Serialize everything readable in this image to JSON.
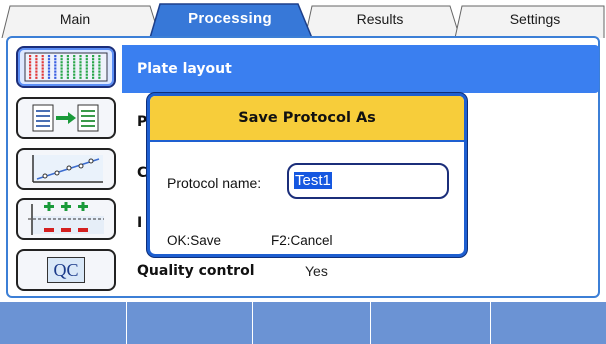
{
  "tabs": [
    {
      "label": "Main",
      "active": false
    },
    {
      "label": "Processing",
      "active": true
    },
    {
      "label": "Results",
      "active": false
    },
    {
      "label": "Settings",
      "active": false
    }
  ],
  "items": [
    {
      "icon": "plate-layout-icon",
      "label": "Plate layout",
      "selected": true
    },
    {
      "icon": "transform-icon",
      "label": "P",
      "selected": false
    },
    {
      "icon": "curve-fit-icon",
      "label": "C",
      "selected": false
    },
    {
      "icon": "cutoff-icon",
      "label": "I",
      "selected": false
    },
    {
      "icon": "qc-icon",
      "label": "Quality control",
      "value": "Yes",
      "selected": false
    }
  ],
  "qc_icon_text": "QC",
  "dialog": {
    "title": "Save Protocol As",
    "field_label": "Protocol name:",
    "field_value": "Test1",
    "ok_hint": "OK:Save",
    "cancel_hint": "F2:Cancel"
  },
  "softkeys": [
    "",
    "",
    "",
    "",
    ""
  ],
  "colors": {
    "accent": "#3a7ff0",
    "tab_active": "#3778d8",
    "dialog_title": "#f7cd3a",
    "softkey_bar": "#6b93d4"
  }
}
